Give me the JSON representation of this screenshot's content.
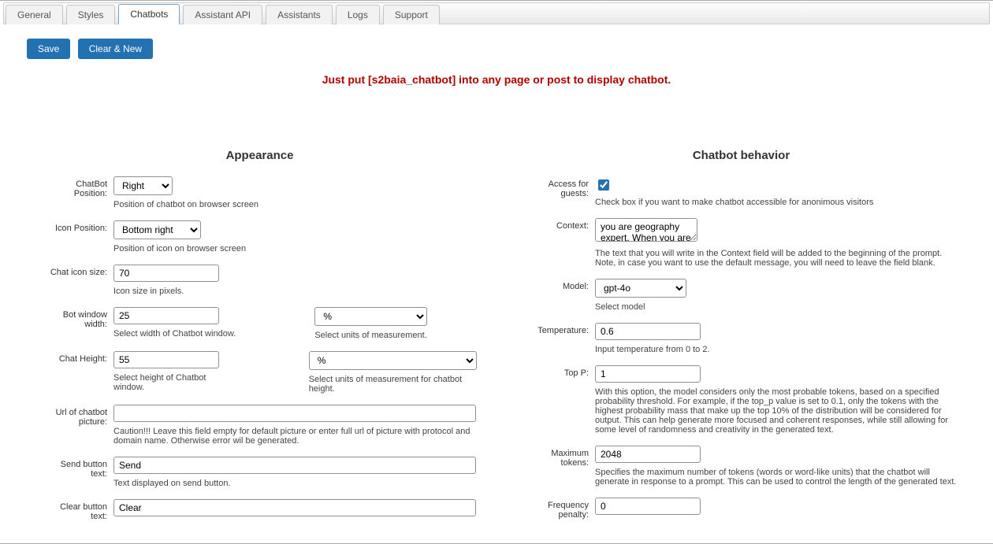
{
  "tabs": {
    "general": "General",
    "styles": "Styles",
    "chatbots": "Chatbots",
    "assistant_api": "Assistant API",
    "assistants": "Assistants",
    "logs": "Logs",
    "support": "Support",
    "active": "chatbots"
  },
  "toolbar": {
    "save": "Save",
    "clear_new": "Clear & New"
  },
  "hint": "Just put [s2baia_chatbot] into any page or post to display chatbot.",
  "sections": {
    "appearance": "Appearance",
    "behavior": "Chatbot behavior"
  },
  "appearance": {
    "chatbot_position": {
      "label": "ChatBot Position:",
      "value": "Right",
      "desc": "Position of chatbot on browser screen"
    },
    "icon_position": {
      "label": "Icon Position:",
      "value": "Bottom right",
      "desc": "Position of icon on browser screen"
    },
    "icon_size": {
      "label": "Chat icon size:",
      "value": "70",
      "desc": "Icon size in pixels."
    },
    "window_width": {
      "label": "Bot window width:",
      "value": "25",
      "units_value": "%",
      "desc": "Select width of Chatbot window.",
      "units_desc": "Select units of measurement."
    },
    "chat_height": {
      "label": "Chat Height:",
      "value": "55",
      "units_value": "%",
      "desc": "Select height of Chatbot window.",
      "units_desc": "Select units of measurement for chatbot height."
    },
    "picture_url": {
      "label": "Url of chatbot picture:",
      "value": "",
      "desc": "Caution!!! Leave this field empty for default picture or enter full url of picture with protocol and domain name. Otherwise error wil be generated."
    },
    "send_text": {
      "label": "Send button text:",
      "value": "Send",
      "desc": "Text displayed on send button."
    },
    "clear_text": {
      "label": "Clear button text:",
      "value": "Clear"
    }
  },
  "behavior": {
    "access_guests": {
      "label": "Access for guests:",
      "checked": true,
      "desc": "Check box if you want to make chatbot accessible for anonimous visitors"
    },
    "context": {
      "label": "Context:",
      "value": "you are geography expert. When you are asked by",
      "desc": "The text that you will write in the Context field will be added to the beginning of the prompt. Note, in case you want to use the default message, you will need to leave the field blank."
    },
    "model": {
      "label": "Model:",
      "value": "gpt-4o",
      "desc": "Select model"
    },
    "temperature": {
      "label": "Temperature:",
      "value": "0.6",
      "desc": "Input temperature from 0 to 2."
    },
    "top_p": {
      "label": "Top P:",
      "value": "1",
      "desc": "With this option, the model considers only the most probable tokens, based on a specified probability threshold. For example, if the top_p value is set to 0.1, only the tokens with the highest probability mass that make up the top 10% of the distribution will be considered for output. This can help generate more focused and coherent responses, while still allowing for some level of randomness and creativity in the generated text."
    },
    "max_tokens": {
      "label": "Maximum tokens:",
      "value": "2048",
      "desc": "Specifies the maximum number of tokens (words or word-like units) that the chatbot will generate in response to a prompt. This can be used to control the length of the generated text."
    },
    "freq_penalty": {
      "label": "Frequency penalty:",
      "value": "0"
    }
  }
}
